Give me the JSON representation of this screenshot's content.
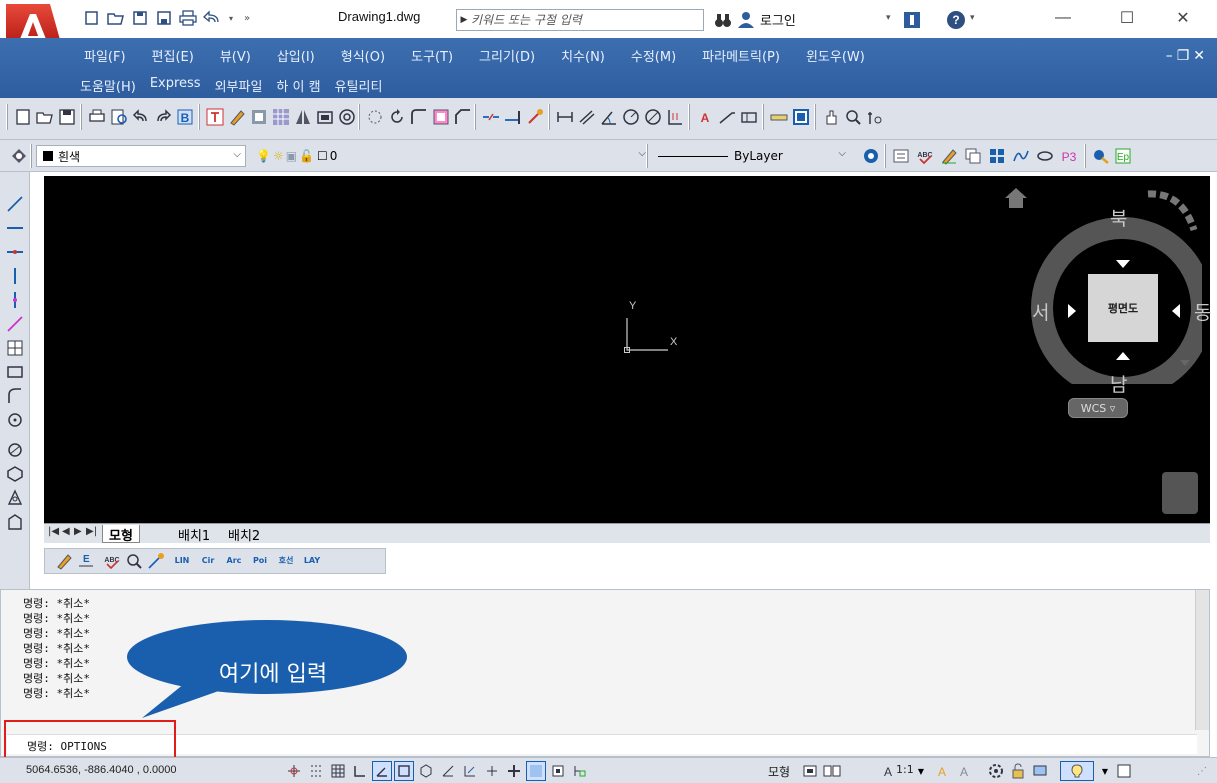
{
  "titlebar": {
    "document_title": "Drawing1.dwg",
    "search_placeholder": "키워드 또는 구절 입력",
    "login_label": "로그인"
  },
  "menu": {
    "row1": [
      "파일(F)",
      "편집(E)",
      "뷰(V)",
      "삽입(I)",
      "형식(O)",
      "도구(T)",
      "그리기(D)",
      "치수(N)",
      "수정(M)",
      "파라메트릭(P)",
      "윈도우(W)"
    ],
    "row2": [
      "도움말(H)",
      "Express",
      "외부파일",
      "하 이 캠",
      "유틸리티"
    ]
  },
  "layer_toolbar": {
    "color_combo_value": "흰색",
    "layer_combo_value": "0",
    "linetype_value": "ByLayer"
  },
  "viewcube": {
    "north": "북",
    "south": "남",
    "east": "동",
    "west": "서",
    "face_label": "평면도",
    "wcs_label": "WCS"
  },
  "ucs": {
    "y_label": "Y",
    "x_label": "X"
  },
  "tabs": [
    {
      "label": "모형",
      "active": true
    },
    {
      "label": "배치1",
      "active": false
    },
    {
      "label": "배치2",
      "active": false
    }
  ],
  "small_toolbar": {
    "buttons": [
      "LIN",
      "Cir",
      "Arc",
      "Poi",
      "호선",
      "LAY"
    ]
  },
  "command": {
    "history": [
      "명령: *취소*",
      "명령: *취소*",
      "명령: *취소*",
      "명령: *취소*",
      "명령: *취소*",
      "명령: *취소*",
      "명령: *취소*"
    ],
    "current_input": "명령: OPTIONS"
  },
  "callout": {
    "text": "여기에 입력"
  },
  "statusbar": {
    "coordinates": "5064.6536, -886.4040 , 0.0000",
    "model_label": "모형",
    "scale_label": "1:1"
  },
  "colors": {
    "menubar": "#2e5d9e",
    "callout": "#1a5fae",
    "highlight": "#e21b1b",
    "canvas": "#000000"
  }
}
